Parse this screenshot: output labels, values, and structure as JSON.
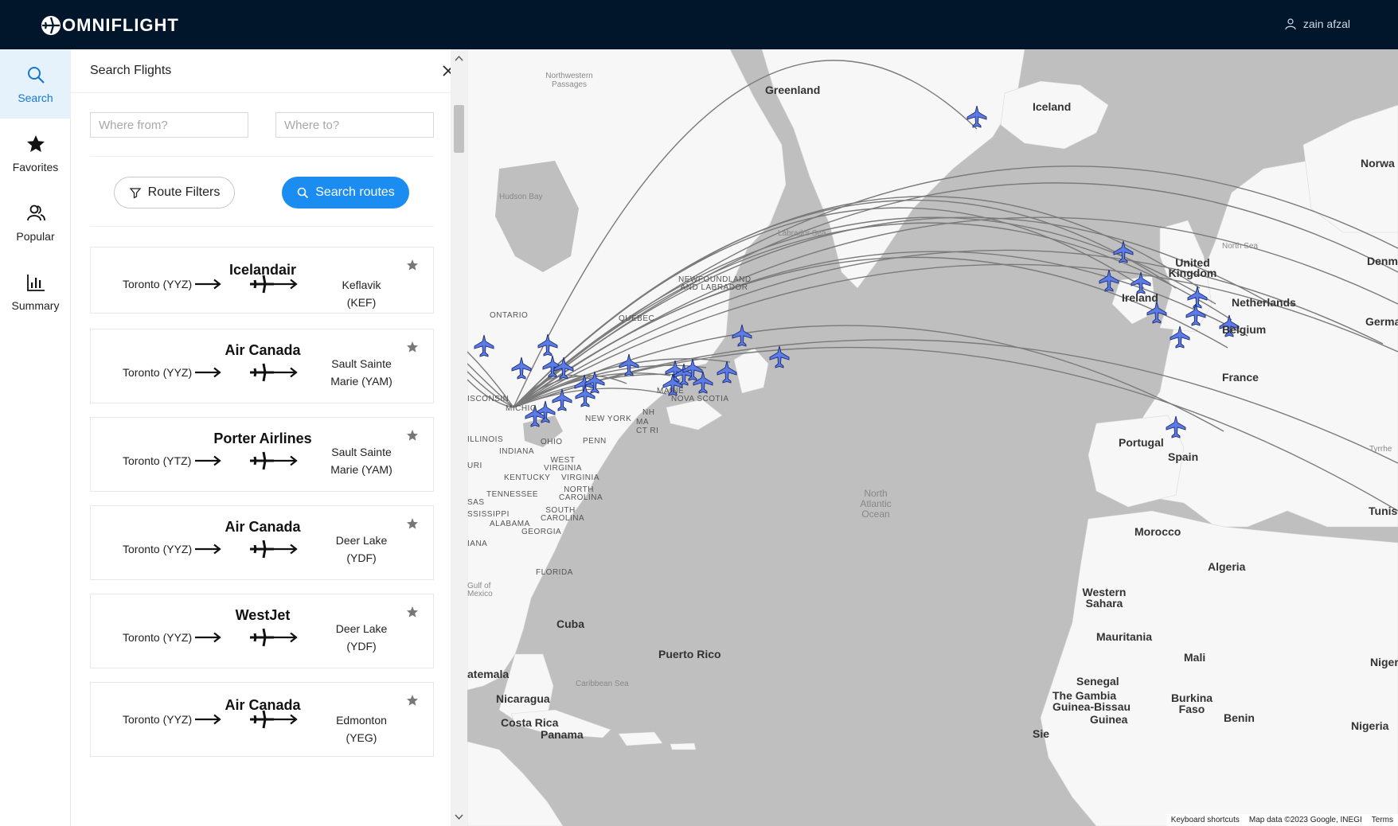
{
  "app": {
    "brand": "OMNIFLIGHT",
    "user_name": "zain afzal"
  },
  "rail": {
    "items": [
      {
        "label": "Search",
        "icon": "search-icon",
        "active": true
      },
      {
        "label": "Favorites",
        "icon": "star-icon",
        "active": false
      },
      {
        "label": "Popular",
        "icon": "people-icon",
        "active": false
      },
      {
        "label": "Summary",
        "icon": "bar-chart-icon",
        "active": false
      }
    ]
  },
  "search": {
    "title": "Search Flights",
    "from_placeholder": "Where from?",
    "to_placeholder": "Where to?",
    "filter_label": "Route Filters",
    "search_label": "Search routes"
  },
  "routes": [
    {
      "airline": "Icelandair",
      "from": "Toronto (YYZ)",
      "to": "Keflavik (KEF)"
    },
    {
      "airline": "Air Canada",
      "from": "Toronto (YYZ)",
      "to": "Sault Sainte Marie (YAM)"
    },
    {
      "airline": "Porter Airlines",
      "from": "Toronto (YTZ)",
      "to": "Sault Sainte Marie (YAM)"
    },
    {
      "airline": "Air Canada",
      "from": "Toronto (YYZ)",
      "to": "Deer Lake (YDF)"
    },
    {
      "airline": "WestJet",
      "from": "Toronto (YYZ)",
      "to": "Deer Lake (YDF)"
    },
    {
      "airline": "Air Canada",
      "from": "Toronto (YYZ)",
      "to": "Edmonton (YEG)"
    }
  ],
  "map": {
    "attribution_shortcuts": "Keyboard shortcuts",
    "attribution_data": "Map data ©2023 Google, INEGI",
    "attribution_terms": "Terms",
    "water_color": "#bfbfbf",
    "land_color": "#f7f7f7",
    "route_color": "#7a7a7a",
    "marker_color": "#5b7be8",
    "labels": {
      "greenland": "Greenland",
      "iceland": "Iceland",
      "norway": "Norwa",
      "nw_passages": "Northwestern Passages",
      "hudson_bay": "Hudson Bay",
      "labrador_sea": "Labrador Sea",
      "north_sea": "North Sea",
      "denmark": "Denm",
      "uk": "United Kingdom",
      "ireland": "Ireland",
      "netherlands": "Netherlands",
      "belgium": "Belgium",
      "germany": "Germa",
      "france": "France",
      "portugal": "Portugal",
      "spain": "Spain",
      "tunisia": "Tunisi",
      "tyrrhenian": "Tyrrhe",
      "morocco": "Morocco",
      "algeria": "Algeria",
      "western_sahara": "Western Sahara",
      "mauritania": "Mauritania",
      "mali": "Mali",
      "niger": "Niger",
      "senegal": "Senegal",
      "gambia": "The Gambia",
      "guinea_bissau": "Guinea-Bissau",
      "guinea": "Guinea",
      "burkina": "Burkina Faso",
      "benin": "Benin",
      "nigeria": "Nigeria",
      "sierra": "Sie",
      "ocean": "North Atlantic Ocean",
      "newfoundland": "NEWFOUNDLAND AND LABRADOR",
      "quebec": "QUEBEC",
      "ontario": "ONTARIO",
      "wisconsin": "ISCONSIN",
      "michigan": "MICHIG",
      "maine": "MAINE",
      "nova_scotia": "NOVA SCOTIA",
      "new_york": "NEW YORK",
      "nh": "NH",
      "ma": "MA",
      "ctri": "CT RI",
      "illinois": "ILLINOIS",
      "ohio": "OHIO",
      "penn": "PENN",
      "indiana": "INDIANA",
      "west_virginia": "WEST VIRGINIA",
      "virginia": "VIRGINIA",
      "kentucky": "KENTUCKY",
      "ri": "URI",
      "tennessee": "TENNESSEE",
      "nc": "NORTH CAROLINA",
      "sc": "SOUTH CAROLINA",
      "georgia": "GEORGIA",
      "alabama": "ALABAMA",
      "mississippi": "SSISSIPPI",
      "kansas": "SAS",
      "iana": "IANA",
      "florida": "FLORIDA",
      "gulf": "Gulf of Mexico",
      "cuba": "Cuba",
      "puerto_rico": "Puerto Rico",
      "caribbean": "Caribbean Sea",
      "guatemala": "atemala",
      "nicaragua": "Nicaragua",
      "costa_rica": "Costa Rica",
      "panama": "Panama"
    }
  }
}
